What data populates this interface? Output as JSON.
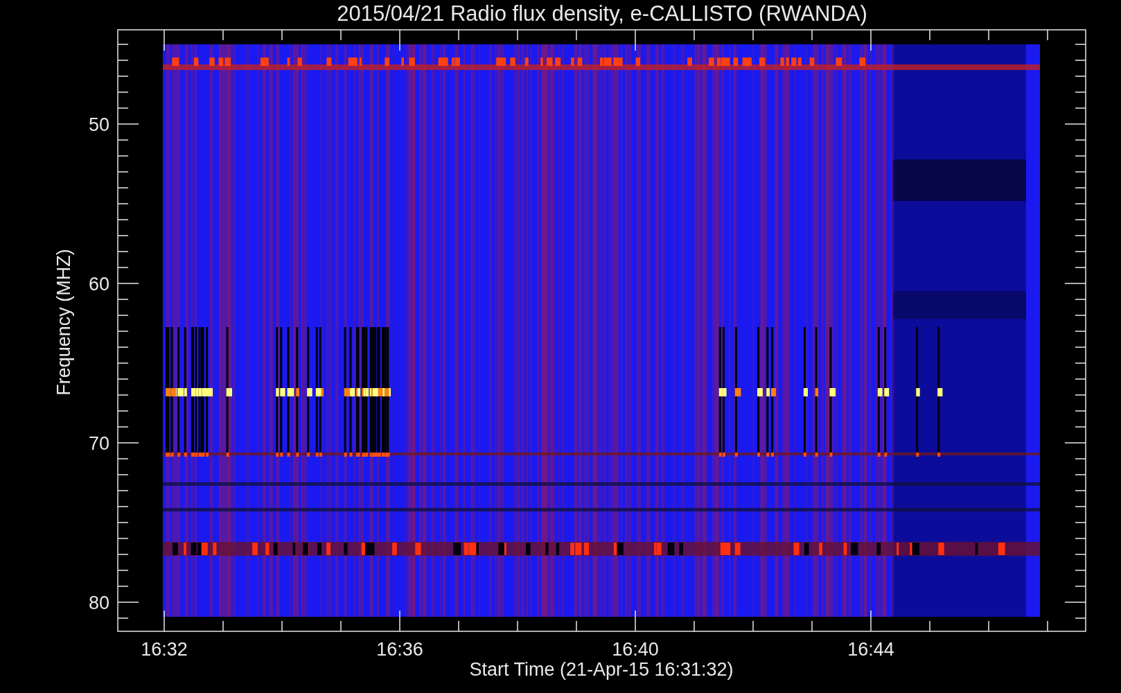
{
  "title": "2015/04/21  Radio flux density, e-CALLISTO (RWANDA)",
  "y_axis": {
    "label": "Frequency (MHZ)",
    "ticks": [
      "50",
      "60",
      "70",
      "80"
    ]
  },
  "x_axis": {
    "label": "Start Time (21-Apr-15 16:31:32)",
    "ticks": [
      "16:32",
      "16:36",
      "16:40",
      "16:44"
    ]
  }
}
